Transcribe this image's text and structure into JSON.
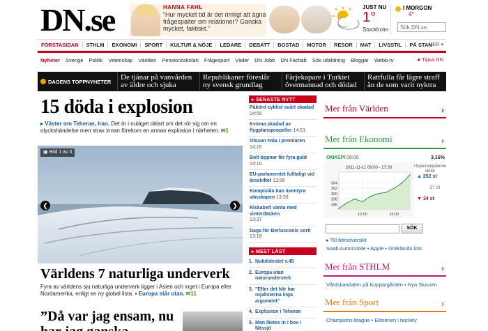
{
  "header": {
    "logo": "DN.se",
    "quote": {
      "author": "HANNA FAHL",
      "text": "”Hur mycket tid är det rimligt att ägna frågespalter om relationer? Ganska mycket, faktiskt.”"
    },
    "weather": {
      "now_label": "JUST NU",
      "temp": "1°",
      "city": "Stockholm",
      "forecast_label": "I MORGON",
      "forecast_temp": "4°"
    },
    "search_placeholder": "Sök DN.se"
  },
  "topnav": {
    "items": [
      "FÖRSTASIDAN",
      "STHLM",
      "EKONOMI",
      "SPORT",
      "KULTUR & NÖJE",
      "LEDARE",
      "DEBATT",
      "BOSTAD",
      "MOTOR",
      "RESOR",
      "MAT",
      "LIVSSTIL",
      "PÅ STAN"
    ],
    "more": "MER"
  },
  "subnav": {
    "items": [
      "Nyheter",
      "Sverige",
      "Politik",
      "Vetenskap",
      "Världen",
      "Pensionsskolan",
      "Frågesport",
      "Väder",
      "DN Jobb",
      "DN Factlab",
      "Sök utbildning",
      "Bloggar",
      "Webb-tv"
    ],
    "tipsa": "Tipsa DN"
  },
  "topbar": {
    "label": "DAGENS TOPPNYHETER",
    "headlines": [
      "De tjänar på vanvården av äldre och sjuka",
      "Republikaner föreslår ny svensk grundlag",
      "Färjekapare i Turkiet övermannad och dödad",
      "Rattfulla får lägre straff än de som varit nyktra"
    ]
  },
  "main": {
    "title": "15 döda i explosion",
    "lead_location": "Väster om Teheran, Iran.",
    "lead_text": " Det är i nuläget oklart om det rör sig om en olyckshändelse men strax innan förekom en annan explosion i närheten.",
    "lead_comments": "1",
    "slide_counter": "Bild 1 av 3",
    "story2_title": "Världens 7 naturliga underverk",
    "story2_text": "Fyra av världens sju naturliga underverk ligger i Asien och inget i Europa eller Nordamerika, enligt en ny global lista.",
    "story2_link": "Europa står utan.",
    "story2_comments": "11",
    "story3_title": "”Då var jag ensam, nu har jag ganska"
  },
  "senaste": {
    "label": "SENASTE NYTT",
    "items": [
      {
        "t": "Påkörd cyklist svårt skadad",
        "tm": "14:55"
      },
      {
        "t": "Kvinna skadad av flygplanspropeller",
        "tm": "14:51"
      },
      {
        "t": "Olsson tvåa i premiären",
        "tm": "14:15"
      },
      {
        "t": "Bolt öppnar för fyra guld",
        "tm": "14:10"
      },
      {
        "t": "EU-parlamentet fulltaligt vid årsskiftet",
        "tm": "13:56"
      },
      {
        "t": "Kompislån kan äventyra vänskapen",
        "tm": "13:39"
      },
      {
        "t": "Riskabelt vänta med vinterdäcken",
        "tm": "13:37"
      },
      {
        "t": "Dags för Berlusconis sorti",
        "tm": "13:19"
      }
    ]
  },
  "mest": {
    "label": "MEST LÄST",
    "items": [
      {
        "n": "1.",
        "t": "Nutidstestet v.45"
      },
      {
        "n": "2.",
        "t": "Europa utan naturunderverk"
      },
      {
        "n": "3.",
        "t": "\"Efter det här har rojalisterna inga argument\""
      },
      {
        "n": "4.",
        "t": "Explosion i Teheran"
      },
      {
        "n": "5.",
        "t": "Man låstes in i box i Nässjö"
      }
    ]
  },
  "right": {
    "varlden": "Mer från Världen",
    "ekonomi": "Mer från Ekonomi",
    "omx_label": "OMXSPI",
    "omx_time": "08:00",
    "omx_change": "3,16%",
    "movers": {
      "title": "Uppe/nedgående aktier",
      "up": "252 st",
      "unchanged": "37 st",
      "down": "34 st"
    },
    "sok_label": "SÖK",
    "borsoversikt": "Till börsöversikt",
    "ekon_links": "Saab Automobile • Apple • Greklands kris",
    "sthlm": "Mer från STHLM",
    "sthlm_links": "Vårdskandalen på Koppargården • Nya Slussen",
    "sport": "Mer från Sport",
    "sport_links": "Champions league • Elitserien i hockey"
  },
  "chart_data": {
    "type": "line",
    "title": "2011-11-11 09:00 - 17:30",
    "x": [
      "09:00",
      "10:00",
      "11:00",
      "12:00",
      "13:00",
      "14:00",
      "15:00",
      "16:00",
      "17:00",
      "17:30"
    ],
    "series": [
      {
        "values": [
          294.5,
          296.5,
          298,
          297,
          299,
          300,
          300.5,
          302,
          304,
          307
        ]
      }
    ],
    "x_ticks": [
      "12:00",
      "16:00"
    ],
    "y_ticks": [
      296,
      298,
      300,
      302,
      304
    ],
    "ylim": [
      294,
      308
    ],
    "grid": true
  }
}
